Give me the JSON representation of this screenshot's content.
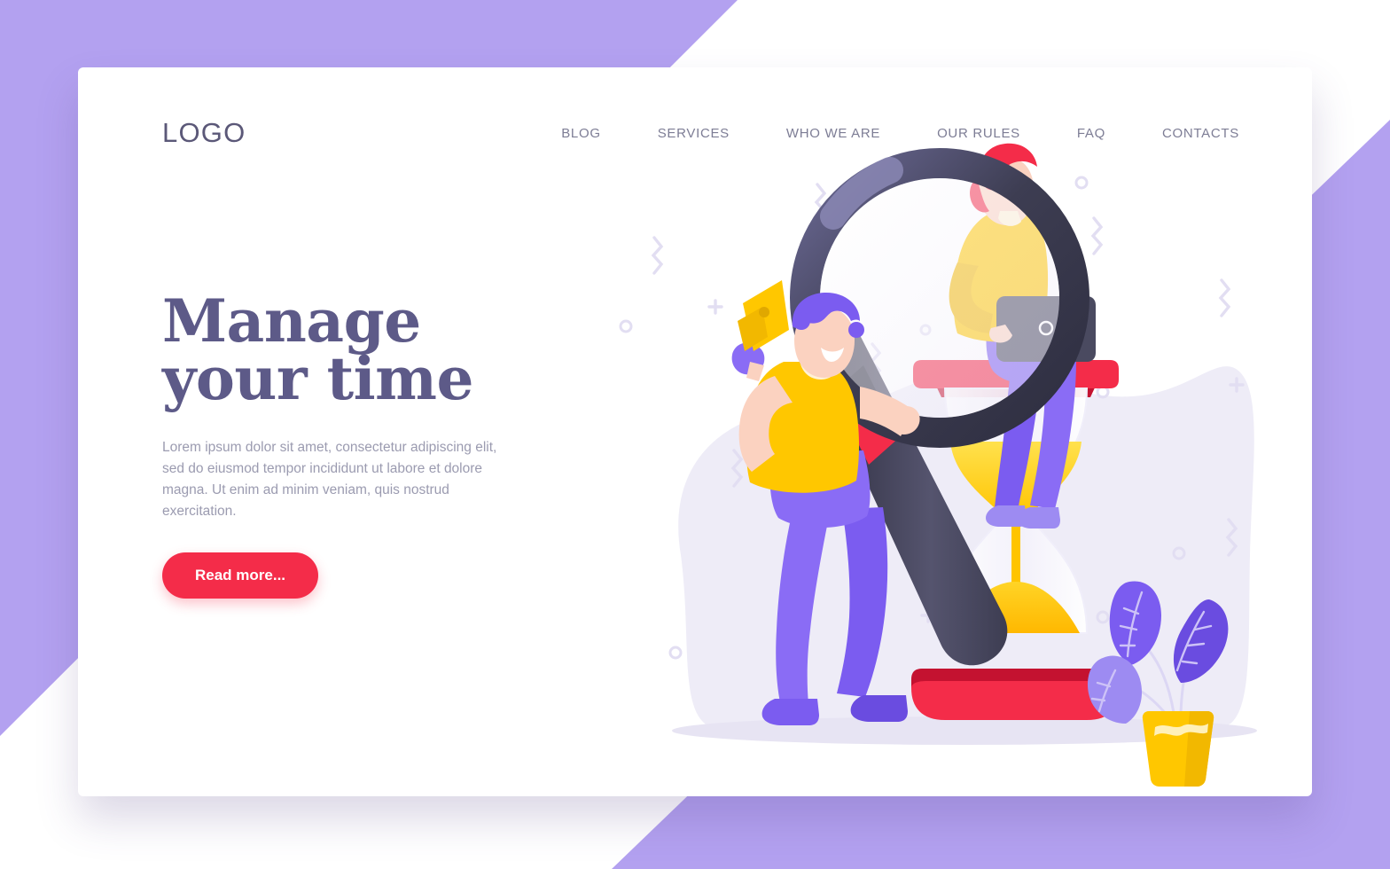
{
  "background": {
    "purple": "#b3a1f0",
    "white": "#ffffff"
  },
  "card": {
    "background": "#ffffff"
  },
  "header": {
    "logo": "LOGO",
    "nav": [
      {
        "label": "BLOG",
        "name": "nav-item-blog"
      },
      {
        "label": "SERVICES",
        "name": "nav-item-services"
      },
      {
        "label": "WHO WE ARE",
        "name": "nav-item-who-we-are"
      },
      {
        "label": "OUR RULES",
        "name": "nav-item-our-rules"
      },
      {
        "label": "FAQ",
        "name": "nav-item-faq"
      },
      {
        "label": "CONTACTS",
        "name": "nav-item-contacts"
      }
    ],
    "nav_color": "#7d7d95",
    "logo_color": "#5b5878"
  },
  "hero": {
    "title_line1": "Manage",
    "title_line2": "your time",
    "title_color": "#5d5a88",
    "paragraph": "Lorem ipsum dolor sit amet, consectetur adipiscing elit, sed do eiusmod tempor incididunt ut labore et dolore magna. Ut enim ad minim veniam, quis nostrud exercitation.",
    "paragraph_color": "#9b9bb0",
    "cta_label": "Read more...",
    "cta_color": "#f42c49",
    "cta_text_color": "#ffffff"
  },
  "illustration": {
    "name": "manage-your-time-illustration",
    "blob_color": "#eeecf7",
    "colors": {
      "magnifier_ring_dark": "#3d3d52",
      "magnifier_ring_light": "#6c6a96",
      "magnifier_lens": "#f7f6fb",
      "magnifier_handle": "#4a4a60",
      "handle_grip_red": "#f42c49",
      "hourglass_sand": "#ffc700",
      "hourglass_glass": "#fbfaff",
      "hourglass_base_red": "#f42c49",
      "shirt_yellow": "#ffc700",
      "pants_purple": "#7b5cf0",
      "skin": "#f9c9b6",
      "hair_purple": "#7b5cf0",
      "hair_red": "#f42c49",
      "laptop_dark": "#4a4a60",
      "plant_leaf_purple": "#7b5cf0",
      "plant_leaf_light": "#9d8bf2",
      "plant_pot_yellow": "#ffc700",
      "decor": "#e2def2"
    },
    "elements": [
      "magnifying-glass",
      "man-with-megaphone",
      "woman-with-laptop",
      "hourglass",
      "potted-plant",
      "decorative-squiggles",
      "decorative-circles",
      "decorative-plus-signs"
    ]
  }
}
